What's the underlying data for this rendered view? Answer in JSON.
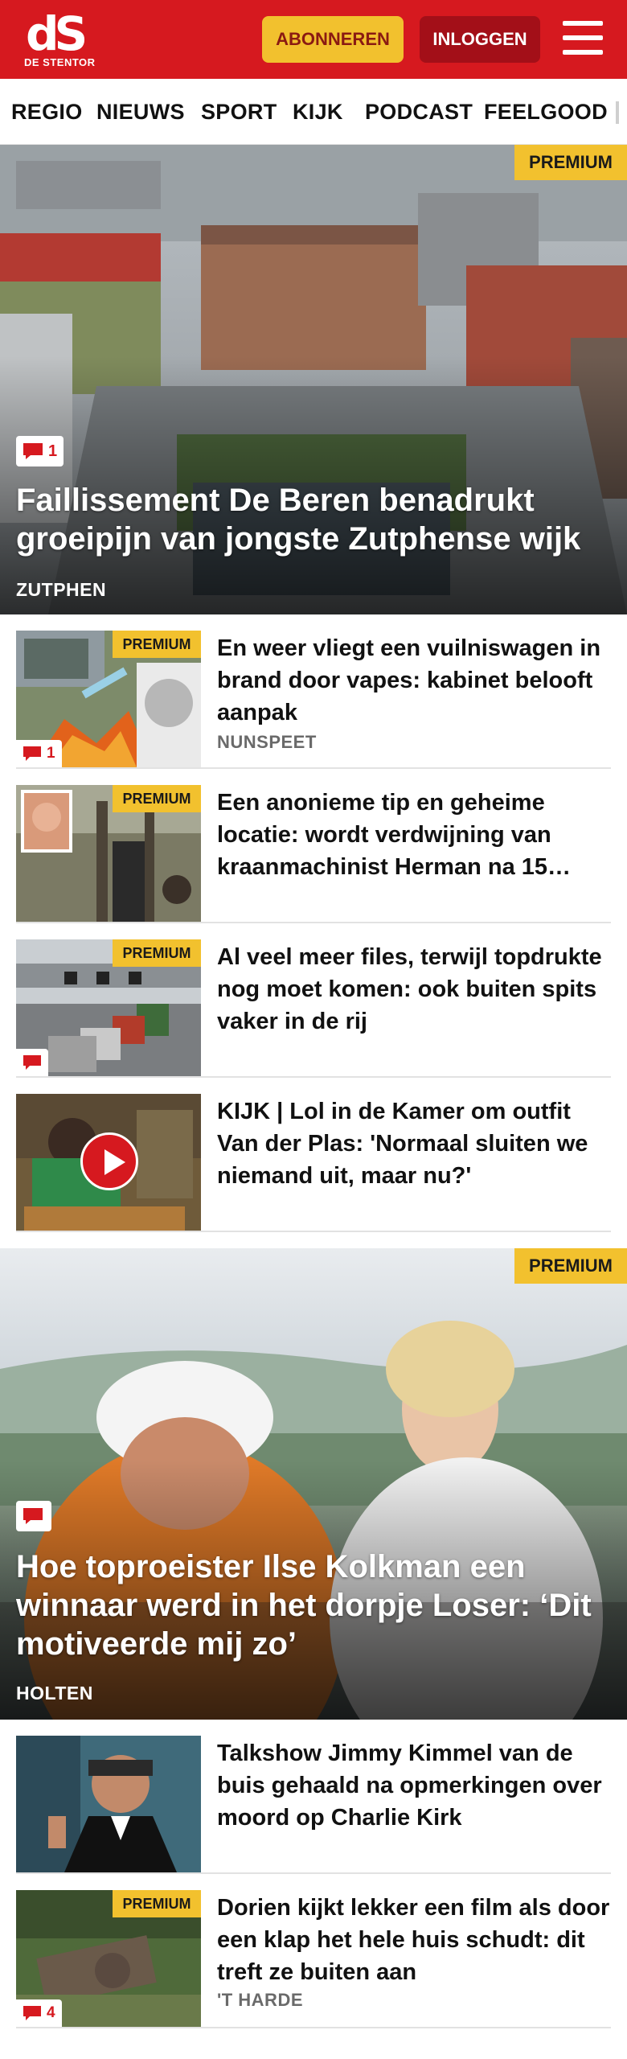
{
  "header": {
    "logo_mark": "dS",
    "logo_sub": "DE STENTOR",
    "subscribe_label": "ABONNEREN",
    "login_label": "INLOGGEN"
  },
  "nav": [
    "REGIO",
    "NIEUWS",
    "SPORT",
    "KIJK",
    "PODCAST",
    "FEELGOOD"
  ],
  "premium_label": "PREMIUM",
  "hero1": {
    "comments": "1",
    "title": "Faillissement De Beren benadrukt groeipijn van jongste Zutphense wijk",
    "region": "ZUTPHEN"
  },
  "articles1": [
    {
      "title": "En weer vliegt een vuilniswagen in brand door vapes: kabinet belooft aanpak",
      "region": "NUNSPEET",
      "comments": "1",
      "premium": true
    },
    {
      "title": "Een anonieme tip en geheime locatie: wordt verdwijning van kraanmachinist Herman na 15…",
      "region": "",
      "comments": "",
      "premium": true
    },
    {
      "title": "Al veel meer files, terwijl topdrukte nog moet komen: ook buiten spits vaker in de rij",
      "region": "",
      "comments": "",
      "premium": true
    },
    {
      "title": "KIJK | Lol in de Kamer om outfit Van der Plas: 'Normaal sluiten we niemand uit, maar nu?'",
      "region": "",
      "comments": "",
      "premium": false
    }
  ],
  "hero2": {
    "comments": "",
    "title": "Hoe toproeister Ilse Kolkman een winnaar werd in het dorpje Loser: ‘Dit motiveerde mij zo’",
    "region": "HOLTEN"
  },
  "articles2": [
    {
      "title": "Talkshow Jimmy Kimmel van de buis gehaald na opmerkingen over moord op Charlie Kirk",
      "region": "",
      "comments": "",
      "premium": false
    },
    {
      "title": "Dorien kijkt lekker een film als door een klap het hele huis schudt: dit treft ze buiten aan",
      "region": "'T HARDE",
      "comments": "4",
      "premium": true
    }
  ],
  "colors": {
    "brand_red": "#d6191f",
    "premium_yellow": "#f2c12e",
    "login_dark_red": "#a30f18"
  },
  "icons": [
    "menu-icon",
    "comment-icon",
    "play-icon"
  ]
}
